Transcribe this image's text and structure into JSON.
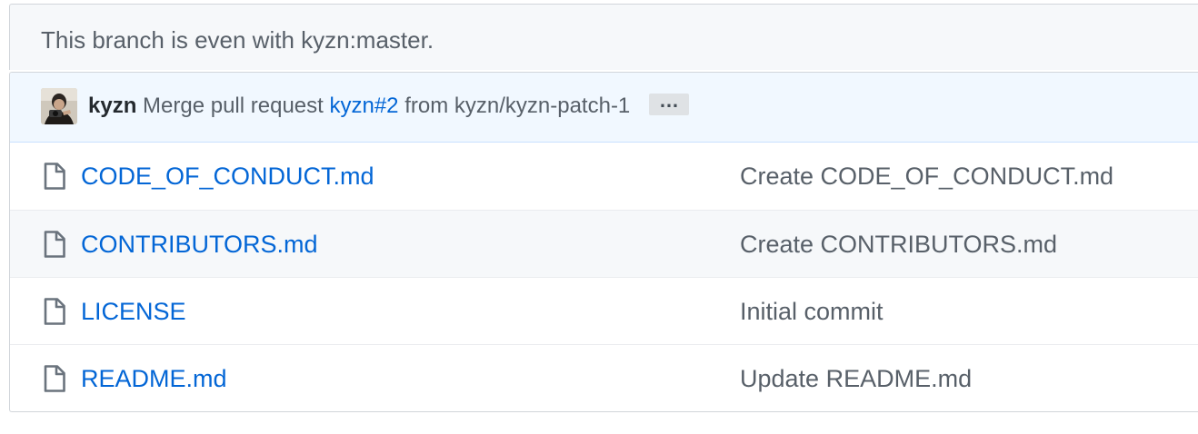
{
  "branch_status": {
    "text": "This branch is even with kyzn:master."
  },
  "latest_commit": {
    "author": "kyzn",
    "message_prefix": "Merge pull request",
    "pr_link": "kyzn#2",
    "message_suffix": "from kyzn/kyzn-patch-1",
    "ellipsis_label": "…",
    "avatar_icon": "user-avatar"
  },
  "files": [
    {
      "name": "CODE_OF_CONDUCT.md",
      "message": "Create CODE_OF_CONDUCT.md",
      "icon": "file-icon"
    },
    {
      "name": "CONTRIBUTORS.md",
      "message": "Create CONTRIBUTORS.md",
      "icon": "file-icon"
    },
    {
      "name": "LICENSE",
      "message": "Initial commit",
      "icon": "file-icon"
    },
    {
      "name": "README.md",
      "message": "Update README.md",
      "icon": "file-icon"
    }
  ],
  "colors": {
    "link": "#0366d6",
    "muted_text": "#586069",
    "commit_bar_bg": "#f1f8ff",
    "border": "#d1d5da"
  }
}
